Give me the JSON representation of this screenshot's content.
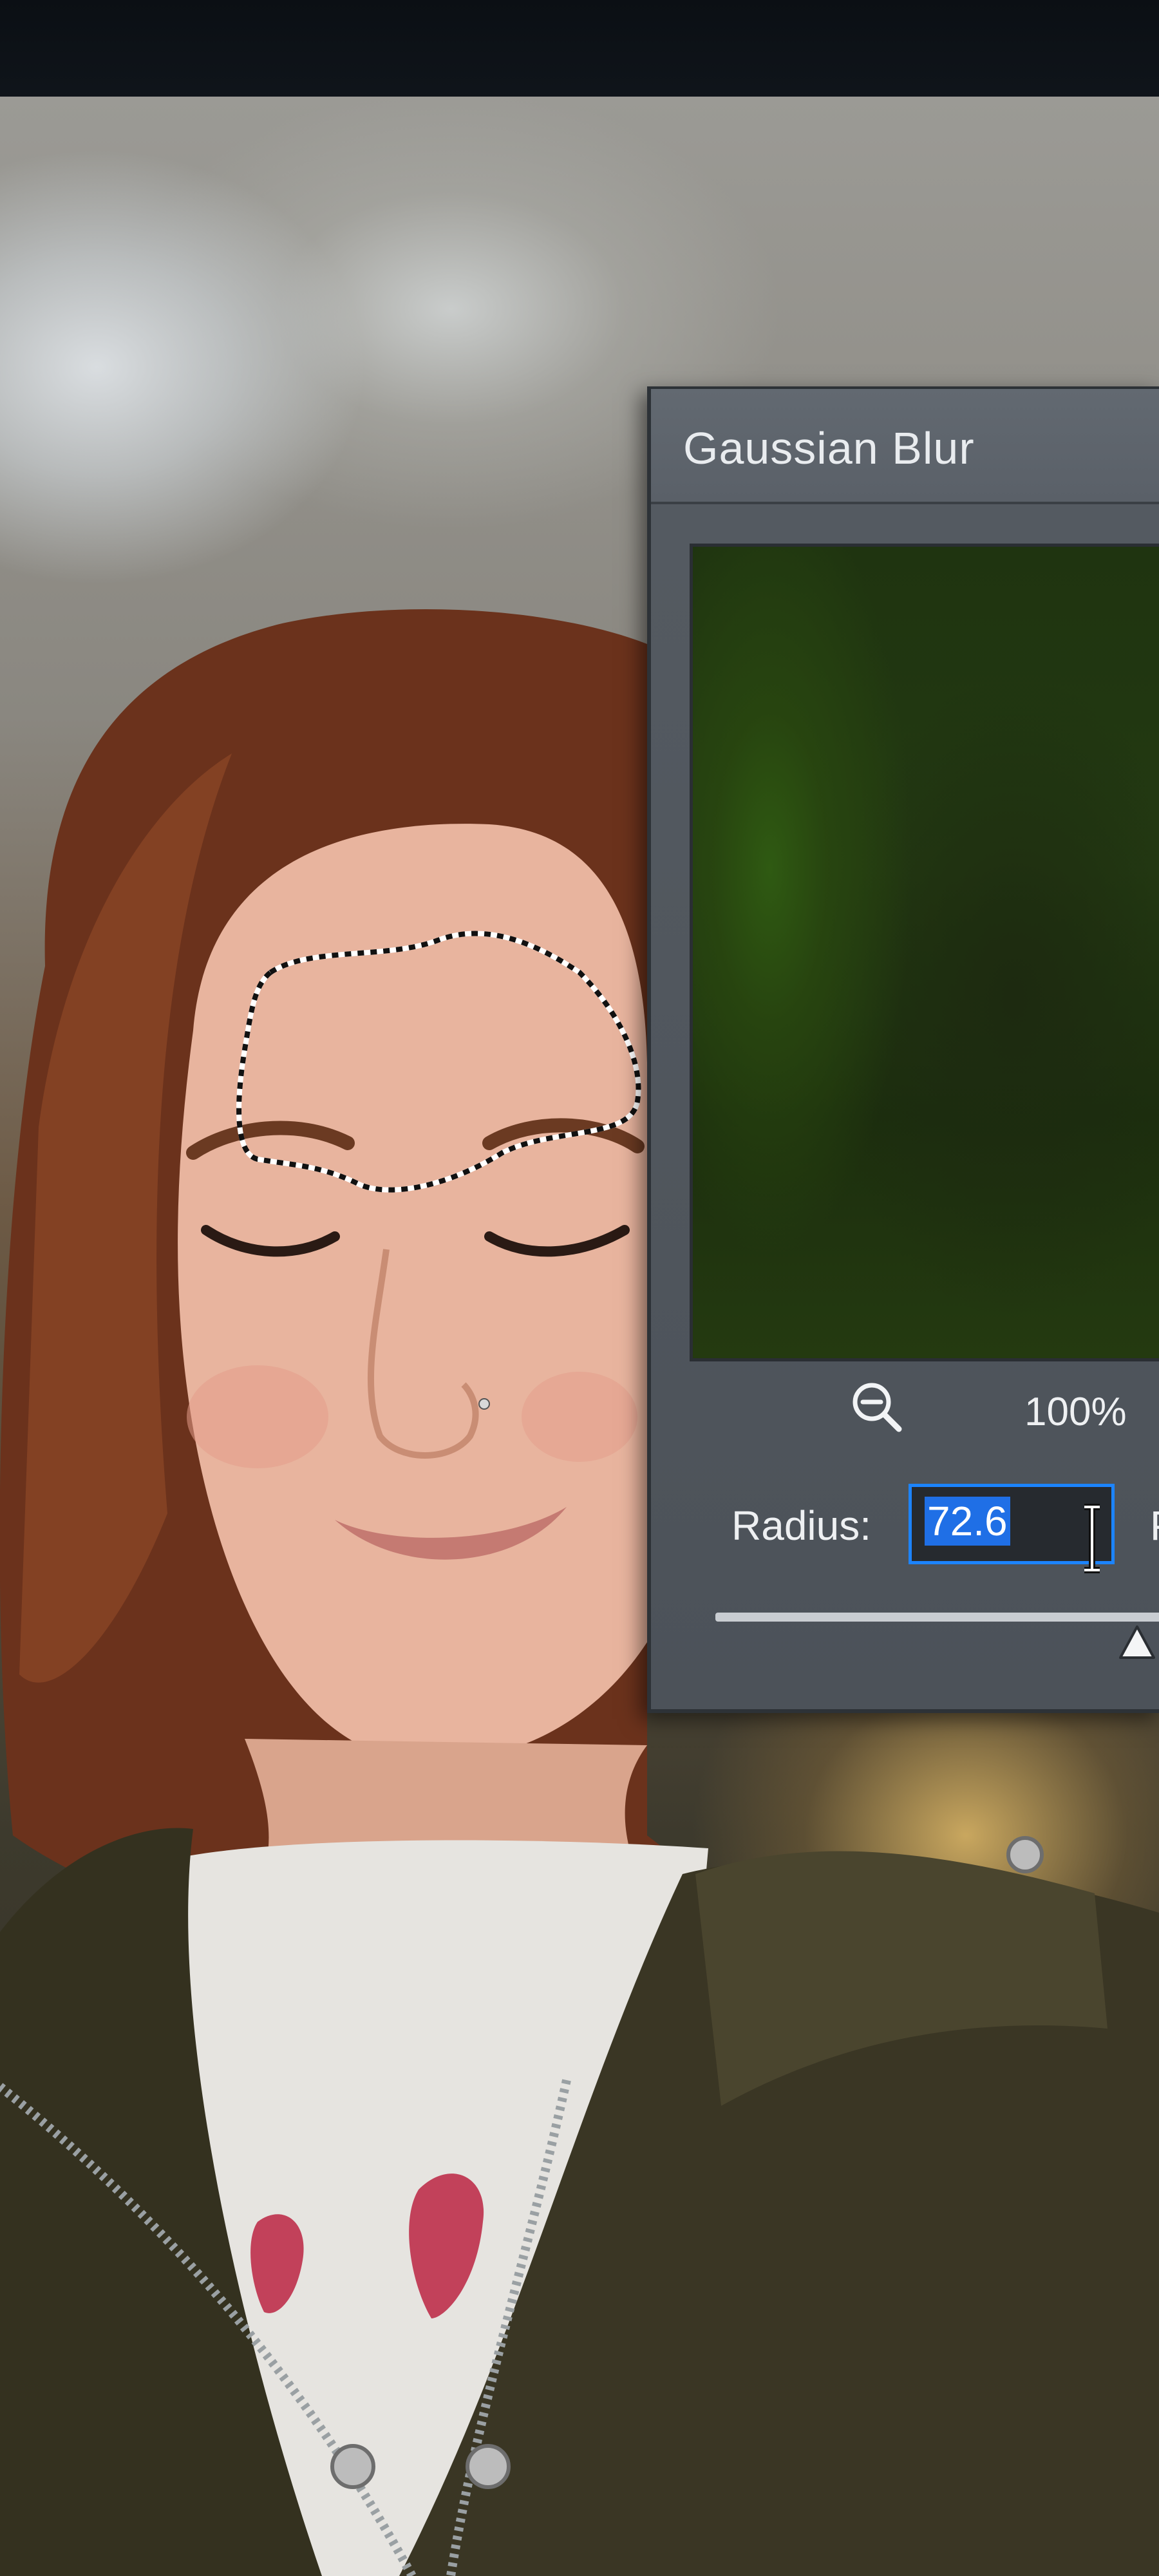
{
  "dialog": {
    "title": "Gaussian Blur",
    "zoom_level": "100%",
    "radius_label": "Radius:",
    "radius_value": "72.6",
    "unit_label": "P",
    "slider_position": 0.98
  },
  "icons": {
    "zoom_out": "zoom-out-icon",
    "text_cursor": "ibeam-cursor-icon",
    "slider_thumb": "triangle-thumb-icon"
  },
  "colors": {
    "dialog_bg": "#4c5259",
    "selection_highlight": "#1f6fe6",
    "input_border": "#1c84ff"
  }
}
